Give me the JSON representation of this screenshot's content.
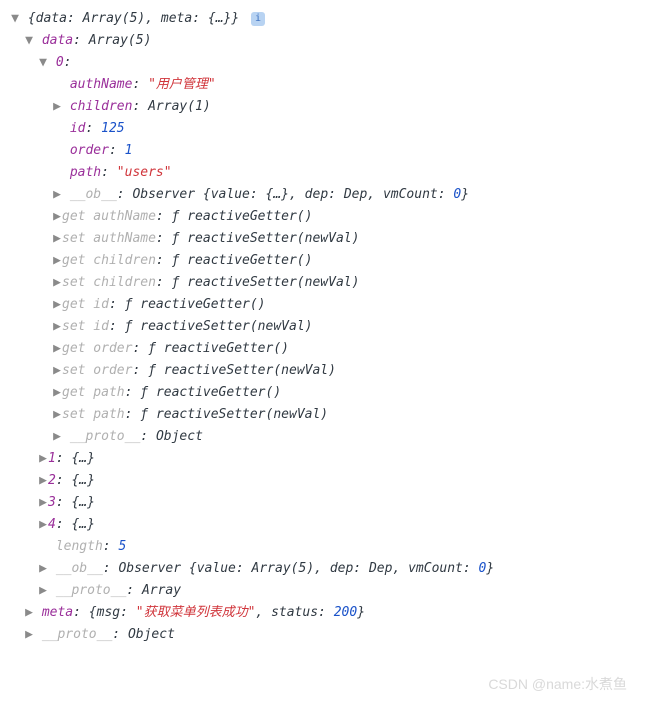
{
  "root": {
    "summary_open": "{",
    "summary_data_key": "data",
    "summary_data_val": "Array(5)",
    "summary_meta_key": "meta",
    "summary_meta_val": "{…}",
    "summary_close": "}",
    "info": "i"
  },
  "data": {
    "key": "data",
    "label": "Array(5)",
    "item0": {
      "key": "0",
      "authName": {
        "key": "authName",
        "value": "\"用户管理\""
      },
      "children": {
        "key": "children",
        "value": "Array(1)"
      },
      "id": {
        "key": "id",
        "value": "125"
      },
      "order": {
        "key": "order",
        "value": "1"
      },
      "path": {
        "key": "path",
        "value": "\"users\""
      },
      "ob": {
        "key": "__ob__",
        "prefix": "Observer {",
        "value_key": "value",
        "value_val": "{…}",
        "dep_key": "dep",
        "dep_val": "Dep",
        "vm_key": "vmCount",
        "vm_val": "0",
        "suffix": "}"
      },
      "accessors": [
        {
          "kind": "get",
          "name": "authName",
          "fn": "reactiveGetter()"
        },
        {
          "kind": "set",
          "name": "authName",
          "fn": "reactiveSetter(newVal)"
        },
        {
          "kind": "get",
          "name": "children",
          "fn": "reactiveGetter()"
        },
        {
          "kind": "set",
          "name": "children",
          "fn": "reactiveSetter(newVal)"
        },
        {
          "kind": "get",
          "name": "id",
          "fn": "reactiveGetter()"
        },
        {
          "kind": "set",
          "name": "id",
          "fn": "reactiveSetter(newVal)"
        },
        {
          "kind": "get",
          "name": "order",
          "fn": "reactiveGetter()"
        },
        {
          "kind": "set",
          "name": "order",
          "fn": "reactiveSetter(newVal)"
        },
        {
          "kind": "get",
          "name": "path",
          "fn": "reactiveGetter()"
        },
        {
          "kind": "set",
          "name": "path",
          "fn": "reactiveSetter(newVal)"
        }
      ],
      "proto": {
        "key": "__proto__",
        "value": "Object"
      }
    },
    "items_collapsed": [
      {
        "key": "1",
        "value": "{…}"
      },
      {
        "key": "2",
        "value": "{…}"
      },
      {
        "key": "3",
        "value": "{…}"
      },
      {
        "key": "4",
        "value": "{…}"
      }
    ],
    "length": {
      "key": "length",
      "value": "5"
    },
    "ob": {
      "key": "__ob__",
      "prefix": "Observer {",
      "value_key": "value",
      "value_val": "Array(5)",
      "dep_key": "dep",
      "dep_val": "Dep",
      "vm_key": "vmCount",
      "vm_val": "0",
      "suffix": "}"
    },
    "proto": {
      "key": "__proto__",
      "value": "Array"
    }
  },
  "meta": {
    "key": "meta",
    "open": "{",
    "msg_key": "msg",
    "msg_val": "\"获取菜单列表成功\"",
    "status_key": "status",
    "status_val": "200",
    "close": "}"
  },
  "proto": {
    "key": "__proto__",
    "value": "Object"
  },
  "tokens": {
    "colon": ": ",
    "comma": ", ",
    "f": "ƒ "
  },
  "watermark": "CSDN @name:水煮鱼"
}
